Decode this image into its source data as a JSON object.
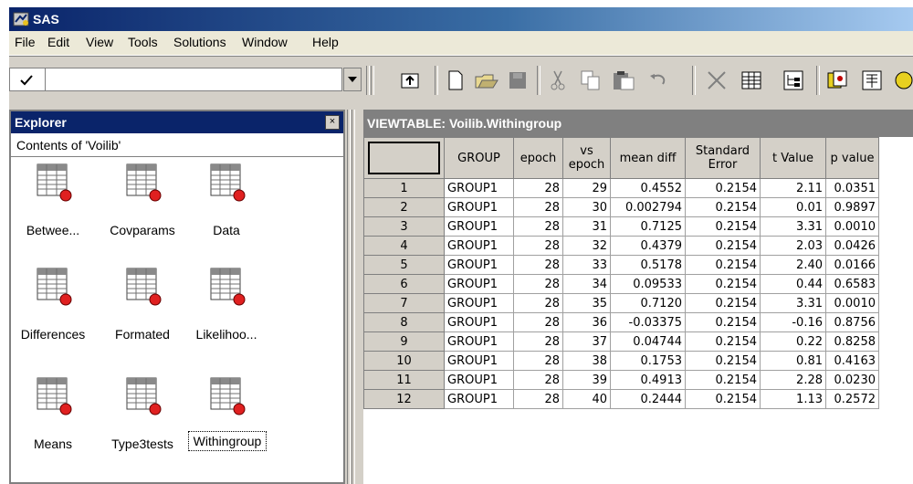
{
  "window": {
    "title": "SAS"
  },
  "menu": [
    "File",
    "Edit",
    "View",
    "Tools",
    "Solutions",
    "Window",
    "Help"
  ],
  "command_box": {
    "value": ""
  },
  "toolbar_icons": [
    "open-folder-icon",
    "new-icon",
    "open-icon",
    "save-icon",
    "cut-icon",
    "copy-icon",
    "paste-icon",
    "undo-icon",
    "delete-icon",
    "grid-icon",
    "tree-icon",
    "explorer-icon",
    "libraries-icon"
  ],
  "explorer": {
    "title": "Explorer",
    "close": "×",
    "contents_label": "Contents of 'Voilib'",
    "items": [
      {
        "label": "Betwee..."
      },
      {
        "label": "Covparams"
      },
      {
        "label": "Data"
      },
      {
        "label": "Differences"
      },
      {
        "label": "Formated"
      },
      {
        "label": "Likelihoo..."
      },
      {
        "label": "Means"
      },
      {
        "label": "Type3tests"
      },
      {
        "label": "Withingroup",
        "selected": true
      }
    ]
  },
  "viewtable": {
    "title": "VIEWTABLE: Voilib.Withingroup",
    "columns": [
      "GROUP",
      "epoch",
      "vs epoch",
      "mean diff",
      "Standard Error",
      "t Value",
      "p value"
    ],
    "rows": [
      [
        "1",
        "GROUP1",
        "28",
        "29",
        "0.4552",
        "0.2154",
        "2.11",
        "0.0351"
      ],
      [
        "2",
        "GROUP1",
        "28",
        "30",
        "0.002794",
        "0.2154",
        "0.01",
        "0.9897"
      ],
      [
        "3",
        "GROUP1",
        "28",
        "31",
        "0.7125",
        "0.2154",
        "3.31",
        "0.0010"
      ],
      [
        "4",
        "GROUP1",
        "28",
        "32",
        "0.4379",
        "0.2154",
        "2.03",
        "0.0426"
      ],
      [
        "5",
        "GROUP1",
        "28",
        "33",
        "0.5178",
        "0.2154",
        "2.40",
        "0.0166"
      ],
      [
        "6",
        "GROUP1",
        "28",
        "34",
        "0.09533",
        "0.2154",
        "0.44",
        "0.6583"
      ],
      [
        "7",
        "GROUP1",
        "28",
        "35",
        "0.7120",
        "0.2154",
        "3.31",
        "0.0010"
      ],
      [
        "8",
        "GROUP1",
        "28",
        "36",
        "-0.03375",
        "0.2154",
        "-0.16",
        "0.8756"
      ],
      [
        "9",
        "GROUP1",
        "28",
        "37",
        "0.04744",
        "0.2154",
        "0.22",
        "0.8258"
      ],
      [
        "10",
        "GROUP1",
        "28",
        "38",
        "0.1753",
        "0.2154",
        "0.81",
        "0.4163"
      ],
      [
        "11",
        "GROUP1",
        "28",
        "39",
        "0.4913",
        "0.2154",
        "2.28",
        "0.0230"
      ],
      [
        "12",
        "GROUP1",
        "28",
        "40",
        "0.2444",
        "0.2154",
        "1.13",
        "0.2572"
      ]
    ]
  }
}
